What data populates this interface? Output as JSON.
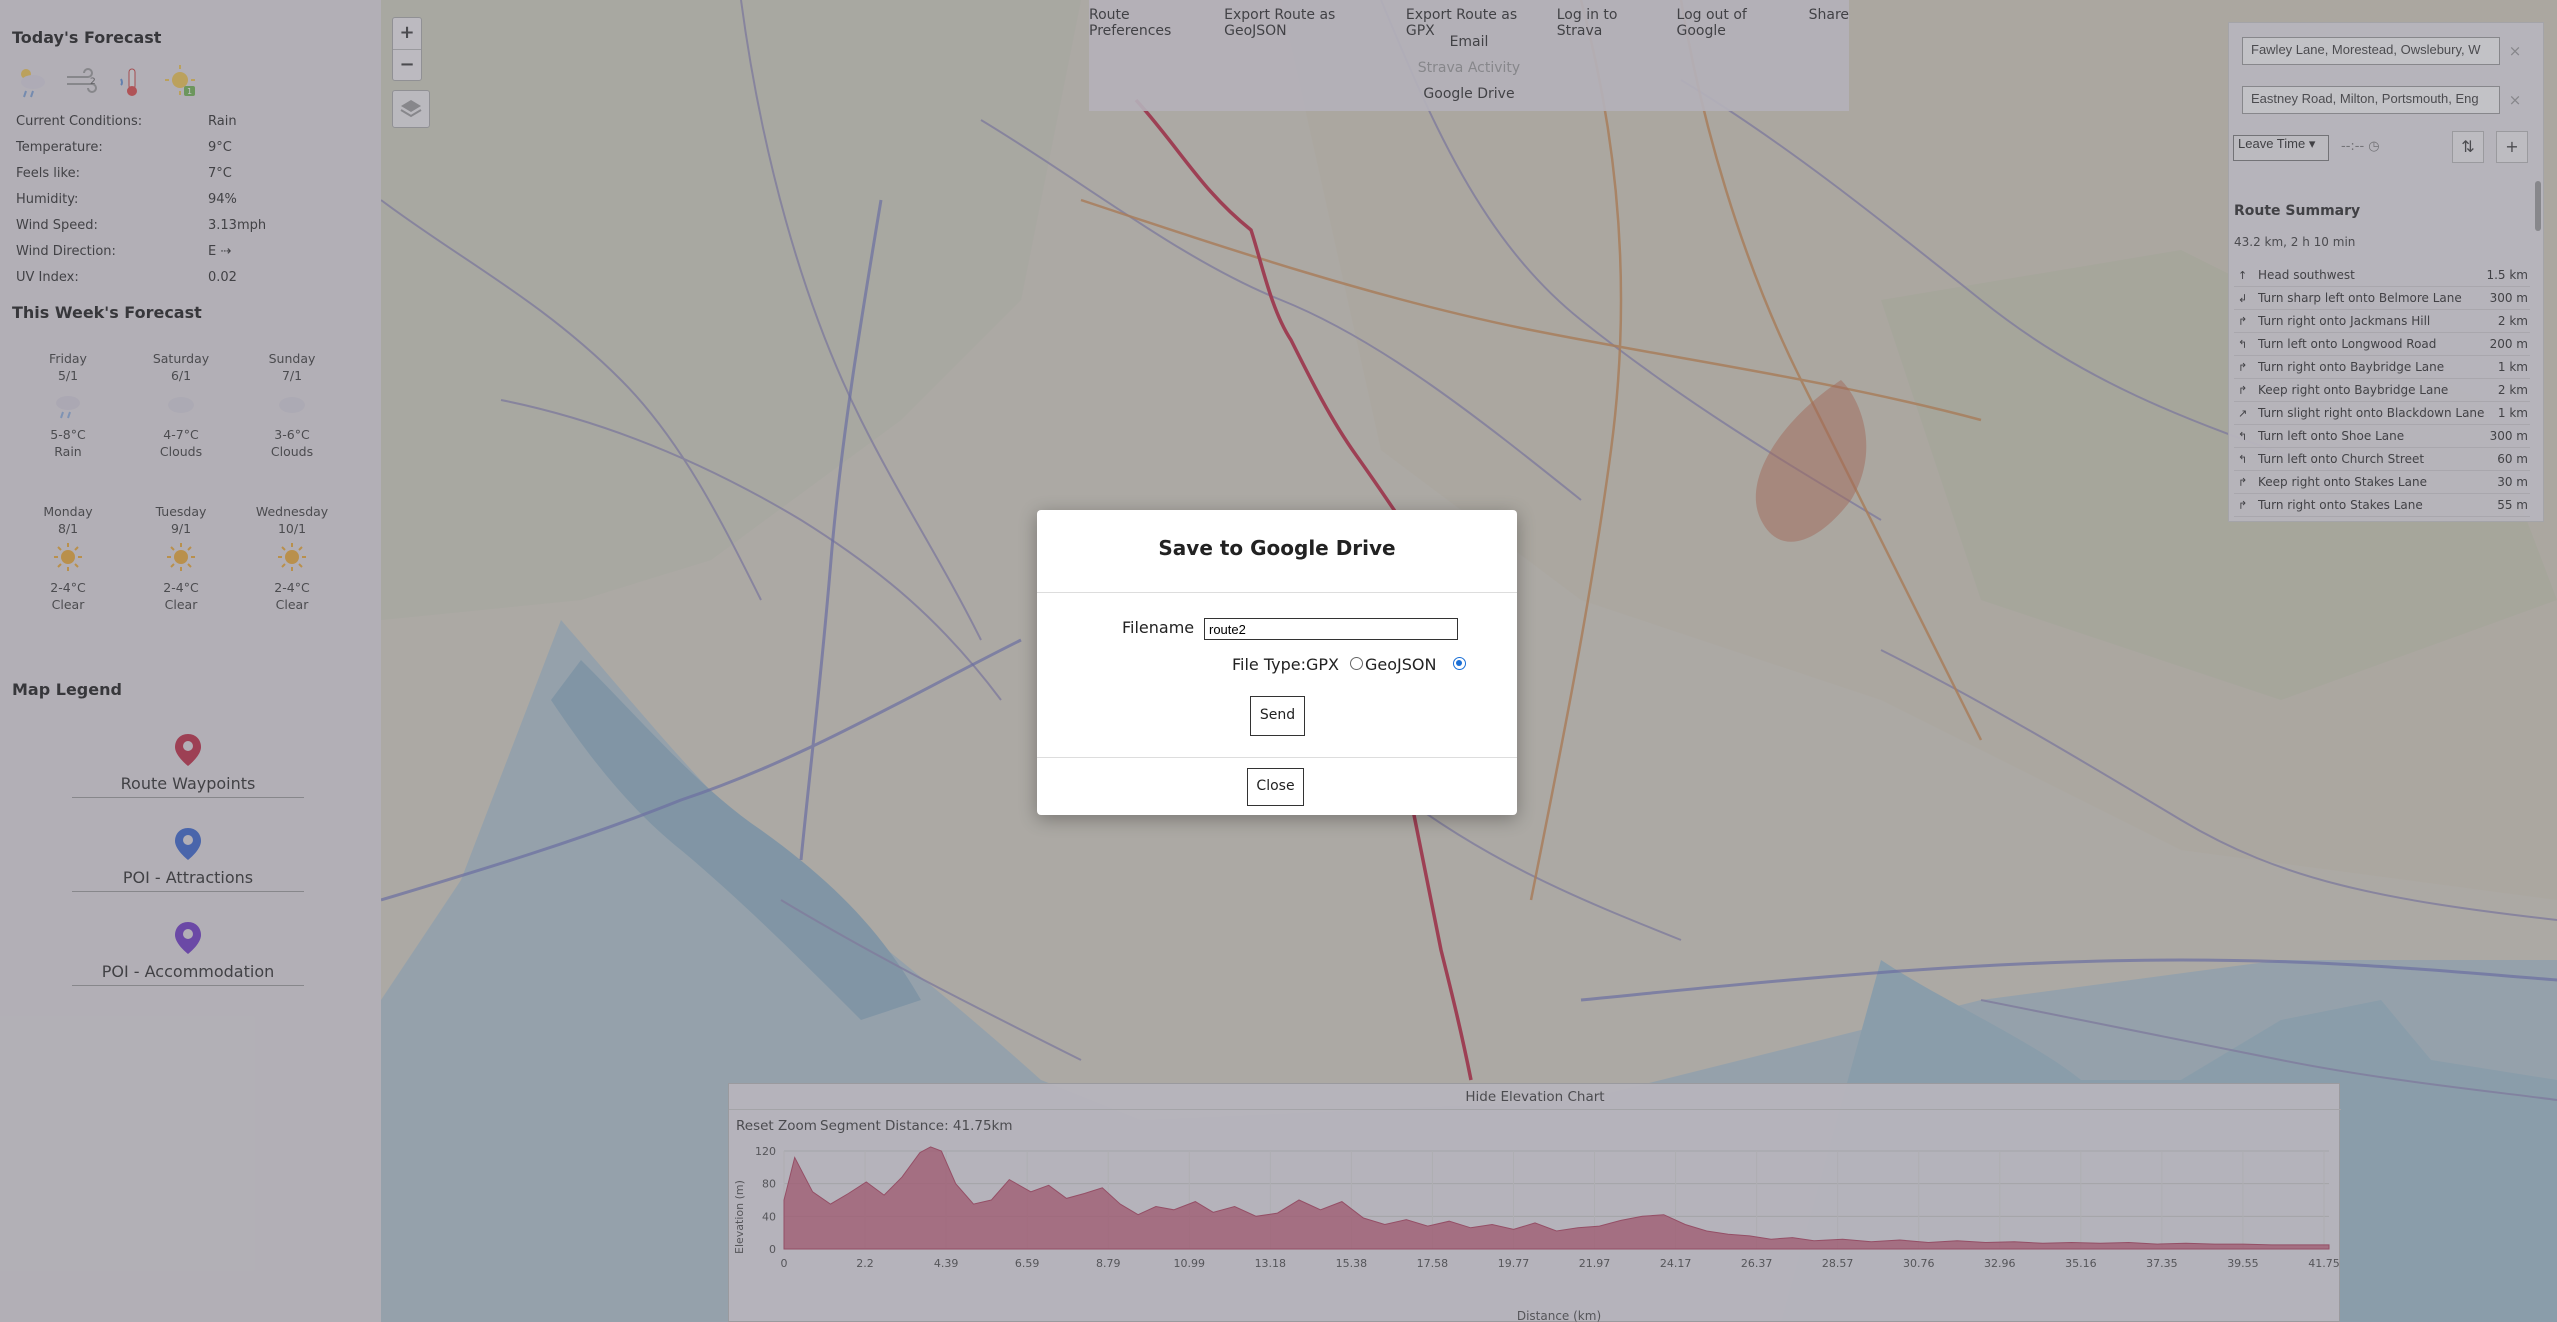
{
  "weather": {
    "today_title": "Today's Forecast",
    "current": [
      {
        "label": "Current Conditions:",
        "value": "Rain"
      },
      {
        "label": "Temperature:",
        "value": "9°C"
      },
      {
        "label": "Feels like:",
        "value": "7°C"
      },
      {
        "label": "Humidity:",
        "value": "94%"
      },
      {
        "label": "Wind Speed:",
        "value": "3.13mph"
      },
      {
        "label": "Wind Direction:",
        "value": "E ⇢"
      },
      {
        "label": "UV Index:",
        "value": "0.02"
      }
    ],
    "week_title": "This Week's Forecast",
    "days": [
      {
        "day": "Friday",
        "date": "5/1",
        "temp": "5-8°C",
        "desc": "Rain",
        "icon": "rain-cloud-icon"
      },
      {
        "day": "Saturday",
        "date": "6/1",
        "temp": "4-7°C",
        "desc": "Clouds",
        "icon": "cloud-icon"
      },
      {
        "day": "Sunday",
        "date": "7/1",
        "temp": "3-6°C",
        "desc": "Clouds",
        "icon": "cloud-icon"
      },
      {
        "day": "Monday",
        "date": "8/1",
        "temp": "2-4°C",
        "desc": "Clear",
        "icon": "sun-icon"
      },
      {
        "day": "Tuesday",
        "date": "9/1",
        "temp": "2-4°C",
        "desc": "Clear",
        "icon": "sun-icon"
      },
      {
        "day": "Wednesday",
        "date": "10/1",
        "temp": "2-4°C",
        "desc": "Clear",
        "icon": "sun-icon"
      }
    ]
  },
  "legend": {
    "title": "Map Legend",
    "items": [
      {
        "label": "Route Waypoints",
        "color": "#c0203c",
        "icon": "map-pin-icon"
      },
      {
        "label": "POI - Attractions",
        "color": "#2f5fd0",
        "icon": "map-pin-icon"
      },
      {
        "label": "POI - Accommodation",
        "color": "#6a2fc8",
        "icon": "map-pin-icon"
      }
    ]
  },
  "map_controls": {
    "zoom_in": "+",
    "zoom_out": "−"
  },
  "top_menu": {
    "items": [
      "Route Preferences",
      "Export Route as GeoJSON",
      "Export Route as GPX",
      "Log in to Strava",
      "Log out of Google",
      "Share"
    ],
    "email": "Email",
    "strava_activity": "Strava Activity",
    "google_drive": "Google Drive"
  },
  "route_panel": {
    "start": "Fawley Lane, Morestead, Owslebury, W",
    "end": "Eastney Road, Milton, Portsmouth, Eng",
    "remove_symbol": "×",
    "leave_time": "Leave Time",
    "time_placeholder": "--:-- ◷",
    "swap_symbol": "⇅",
    "add_symbol": "+",
    "summary_title": "Route Summary",
    "summary": "43.2 km, 2 h 10 min",
    "steps": [
      {
        "arrow": "↑",
        "text": "Head southwest",
        "dist": "1.5 km"
      },
      {
        "arrow": "↲",
        "text": "Turn sharp left onto Belmore Lane",
        "dist": "300 m"
      },
      {
        "arrow": "↱",
        "text": "Turn right onto Jackmans Hill",
        "dist": "2 km"
      },
      {
        "arrow": "↰",
        "text": "Turn left onto Longwood Road",
        "dist": "200 m"
      },
      {
        "arrow": "↱",
        "text": "Turn right onto Baybridge Lane",
        "dist": "1 km"
      },
      {
        "arrow": "↱",
        "text": "Keep right onto Baybridge Lane",
        "dist": "2 km"
      },
      {
        "arrow": "↗",
        "text": "Turn slight right onto Blackdown Lane",
        "dist": "1 km"
      },
      {
        "arrow": "↰",
        "text": "Turn left onto Shoe Lane",
        "dist": "300 m"
      },
      {
        "arrow": "↰",
        "text": "Turn left onto Church Street",
        "dist": "60 m"
      },
      {
        "arrow": "↱",
        "text": "Keep right onto Stakes Lane",
        "dist": "30 m"
      },
      {
        "arrow": "↱",
        "text": "Turn right onto Stakes Lane",
        "dist": "55 m"
      }
    ]
  },
  "elevation": {
    "hide_label": "Hide Elevation Chart",
    "reset_zoom": "Reset Zoom",
    "segment": "Segment Distance: 41.75km"
  },
  "chart_data": {
    "type": "area",
    "xlabel": "Distance (km)",
    "ylabel": "Elevation (m)",
    "ylim": [
      0,
      120
    ],
    "xlim": [
      0,
      43.2
    ],
    "yticks": [
      0,
      40,
      80,
      120
    ],
    "xticks": [
      "0",
      "2.2",
      "4.39",
      "6.59",
      "8.79",
      "10.99",
      "13.18",
      "15.38",
      "17.58",
      "19.77",
      "21.97",
      "24.17",
      "26.37",
      "28.57",
      "30.76",
      "32.96",
      "35.16",
      "37.35",
      "39.55",
      "41.75"
    ],
    "series": [
      {
        "x": [
          0,
          0.3,
          0.8,
          1.3,
          1.8,
          2.3,
          2.8,
          3.3,
          3.8,
          4.1,
          4.4,
          4.8,
          5.3,
          5.8,
          6.3,
          6.9,
          7.4,
          7.9,
          8.4,
          8.9,
          9.4,
          9.9,
          10.4,
          10.9,
          11.5,
          12.0,
          12.6,
          13.2,
          13.8,
          14.4,
          15.0,
          15.6,
          16.2,
          16.8,
          17.4,
          18.0,
          18.6,
          19.2,
          19.8,
          20.4,
          21.0,
          21.6,
          22.2,
          22.8,
          23.4,
          24.0,
          24.6,
          25.2,
          25.8,
          26.4,
          27.0,
          27.6,
          28.2,
          28.8,
          29.6,
          30.4,
          31.2,
          32.0,
          32.8,
          33.6,
          34.4,
          35.2,
          36.0,
          36.8,
          37.6,
          38.4,
          39.2,
          40.0,
          40.8,
          41.6,
          42.4,
          43.2
        ],
        "y": [
          60,
          112,
          70,
          55,
          68,
          82,
          66,
          88,
          118,
          125,
          120,
          80,
          55,
          60,
          85,
          70,
          78,
          62,
          68,
          75,
          55,
          42,
          52,
          48,
          58,
          45,
          52,
          40,
          44,
          60,
          48,
          58,
          38,
          30,
          36,
          28,
          34,
          26,
          30,
          24,
          32,
          22,
          26,
          28,
          35,
          40,
          42,
          30,
          22,
          18,
          16,
          12,
          14,
          10,
          12,
          9,
          11,
          8,
          10,
          8,
          9,
          7,
          8,
          7,
          8,
          6,
          7,
          6,
          6,
          5,
          5,
          5
        ]
      }
    ]
  },
  "modal": {
    "title": "Save to Google Drive",
    "filename_label": "Filename",
    "filename_value": "route2",
    "file_type_label": "File Type:GPX",
    "geojson_label": "GeoJSON",
    "selected": "GeoJSON",
    "send": "Send",
    "close": "Close"
  }
}
